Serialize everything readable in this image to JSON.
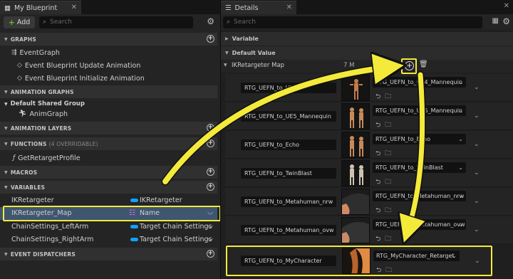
{
  "left": {
    "tab_title": "My Blueprint",
    "add_label": "Add",
    "search_placeholder": "Search",
    "sections": {
      "graphs": "GRAPHS",
      "animation_graphs": "ANIMATION GRAPHS",
      "animation_layers": "ANIMATION LAYERS",
      "functions": "FUNCTIONS",
      "functions_overridable": "(4 OVERRIDABLE)",
      "macros": "MACROS",
      "variables": "VARIABLES",
      "event_dispatchers": "EVENT DISPATCHERS"
    },
    "graph_items": [
      "EventGraph",
      "Event Blueprint Update Animation",
      "Event Blueprint Initialize Animation"
    ],
    "default_shared_group": "Default Shared Group",
    "anim_graph": "AnimGraph",
    "function_items": [
      "GetRetargetProfile"
    ],
    "variables": [
      {
        "name": "IKRetargeter",
        "type": "IKRetargeter"
      },
      {
        "name": "IKRetargeter_Map",
        "type": "Name"
      },
      {
        "name": "ChainSettings_LeftArm",
        "type": "Target Chain Settings"
      },
      {
        "name": "ChainSettings_RightArm",
        "type": "Target Chain Settings"
      }
    ]
  },
  "right": {
    "tab_title": "Details",
    "search_placeholder": "Search",
    "category_variable": "Variable",
    "category_default": "Default Value",
    "map_label": "IKRetargeter Map",
    "map_count": "7 M",
    "entries": [
      {
        "key": "RTG_UEFN_to_UE5",
        "value": "RTG_UEFN_to_UE4_Mannequin"
      },
      {
        "key": "RTG_UEFN_to_UE5_Mannequin",
        "value": "RTG_UEFN_to_UE5_Mannequin"
      },
      {
        "key": "RTG_UEFN_to_Echo",
        "value": "RTG_UEFN_to_Echo"
      },
      {
        "key": "RTG_UEFN_to_TwinBlast",
        "value": "RTG_UEFN_to_TwinBlast"
      },
      {
        "key": "RTG_UEFN_to_Metahuman_nrw",
        "value": "RTG_UEFN_to_Metahuman_nrw"
      },
      {
        "key": "RTG_UEFN_to_Metahuman_ovw",
        "value": "RTG_UEFN_to_Metahuman_ovw"
      },
      {
        "key": "RTG_UEFN_to_MyCharacter",
        "value": "RTG_MyCharacter_Retarget"
      }
    ]
  },
  "colors": {
    "accent_yellow": "#f4ea3a",
    "pill_blue": "#0fa2ff",
    "selection": "#3f5670",
    "add_green": "#5dbd2e"
  }
}
